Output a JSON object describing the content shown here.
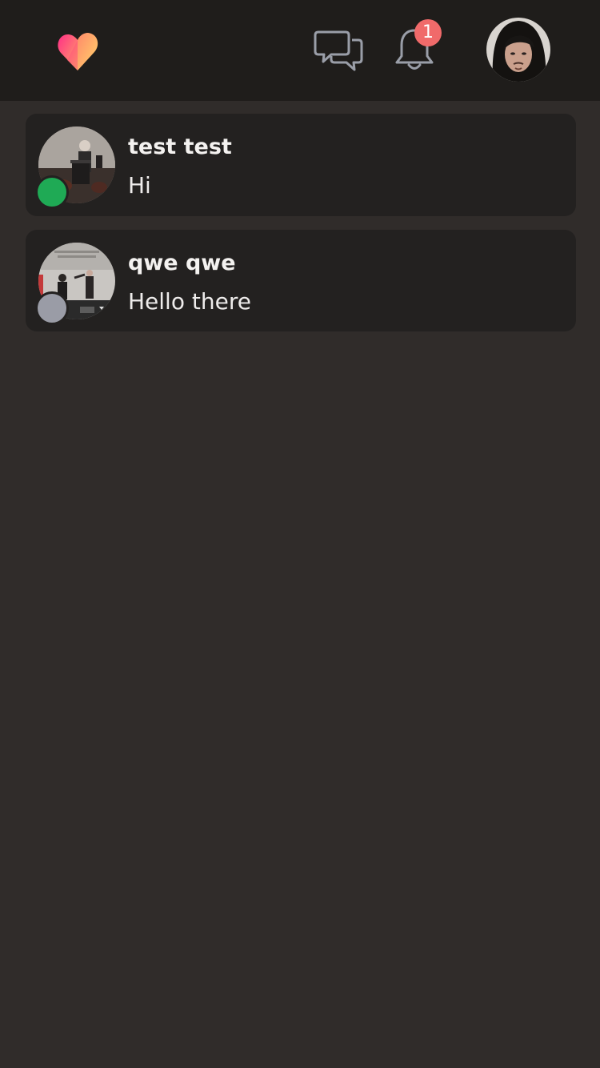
{
  "header": {
    "logo_icon": "heart-logo-icon",
    "messages_icon": "chat-bubbles-icon",
    "notifications_icon": "bell-icon",
    "notification_count": "1",
    "badge_color": "#f06a6a",
    "profile_avatar": "user-avatar"
  },
  "conversations": [
    {
      "name": "test test",
      "last_message": "Hi",
      "status": "online",
      "status_color": "#1faa55"
    },
    {
      "name": "qwe qwe",
      "last_message": "Hello there",
      "status": "offline",
      "status_color": "#9a9ca6"
    }
  ],
  "colors": {
    "background": "#302c2a",
    "topbar": "#1f1d1b",
    "card": "#232120",
    "logo_gradient": [
      "#ff3b8a",
      "#ff8a5c",
      "#ffd35a"
    ]
  }
}
